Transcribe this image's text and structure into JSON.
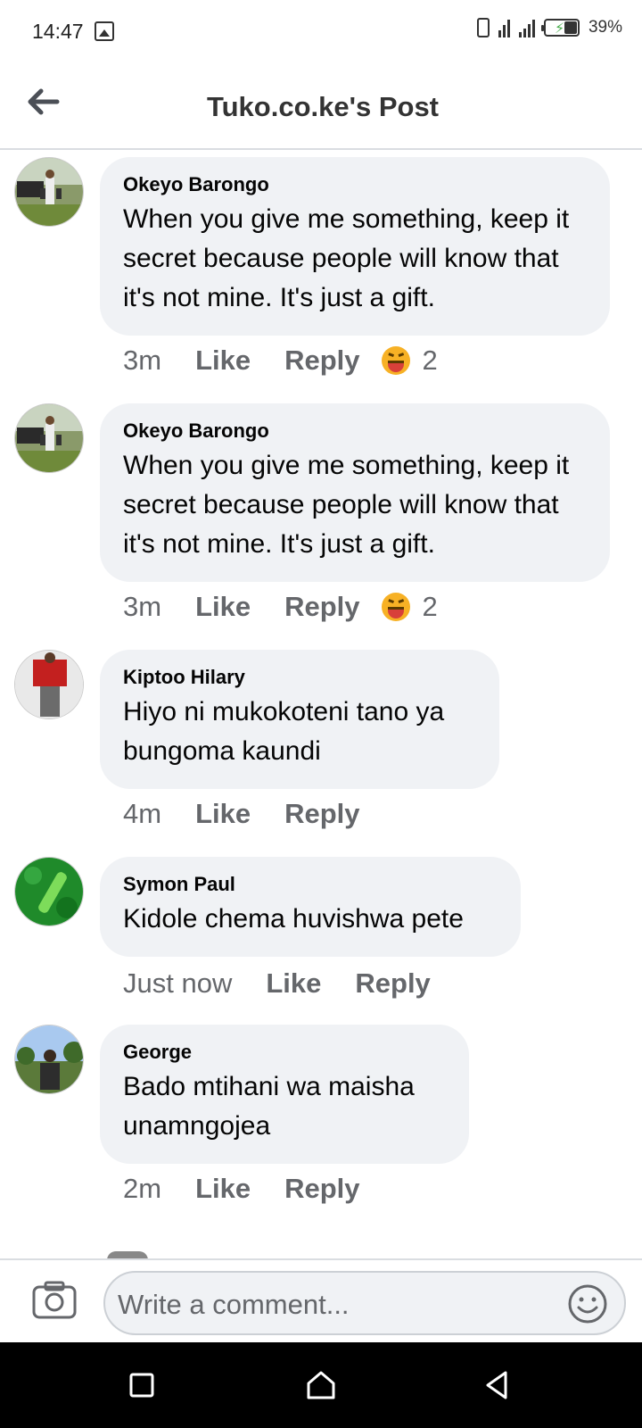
{
  "status_bar": {
    "time": "14:47",
    "battery": "39%"
  },
  "header": {
    "title": "Tuko.co.ke's Post"
  },
  "comments": [
    {
      "author": "Okeyo Barongo",
      "text": "When you give me something, keep it secret because people will know that it's not mine. It's just a gift.",
      "time": "3m",
      "like": "Like",
      "reply": "Reply",
      "reaction": "laughing-emoji",
      "reaction_count": "2"
    },
    {
      "author": "Okeyo Barongo",
      "text": "When you give me something, keep it secret because people will know that it's not mine. It's just a gift.",
      "time": "3m",
      "like": "Like",
      "reply": "Reply",
      "reaction": "laughing-emoji",
      "reaction_count": "2"
    },
    {
      "author": "Kiptoo Hilary",
      "text": "Hiyo ni mukokoteni tano ya bungoma kaundi",
      "time": "4m",
      "like": "Like",
      "reply": "Reply"
    },
    {
      "author": "Symon Paul",
      "text": "Kidole chema huvishwa pete",
      "time": "Just now",
      "like": "Like",
      "reply": "Reply"
    },
    {
      "author": "George",
      "text": "Bado mtihani wa maisha unamngojea",
      "time": "2m",
      "like": "Like",
      "reply": "Reply"
    }
  ],
  "composer": {
    "placeholder": "Write a comment..."
  },
  "colors": {
    "bubble": "#f0f2f5",
    "meta_text": "#65676b",
    "name_text": "#050505"
  }
}
